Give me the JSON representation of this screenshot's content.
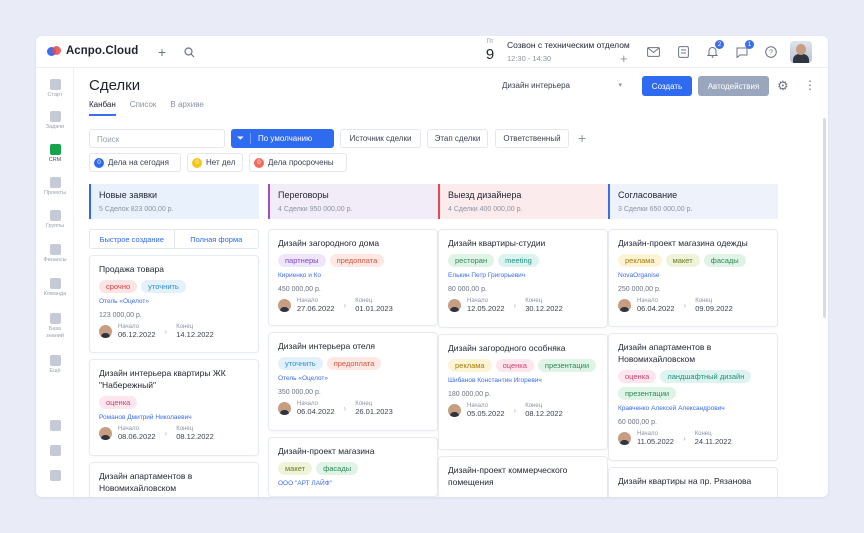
{
  "app": {
    "logo": "Аспро.Cloud"
  },
  "topbar": {
    "date_dow": "Пт",
    "date_num": "9",
    "event_title": "Созвон с техническим отделом",
    "event_time": "12:30 - 14:30",
    "tasks_badge": "2",
    "chat_badge": "1"
  },
  "sidebar": {
    "items": [
      {
        "label": "Старт"
      },
      {
        "label": "Задачи"
      },
      {
        "label": "CRM"
      },
      {
        "label": "Проекты"
      },
      {
        "label": "Группы"
      },
      {
        "label": "Финансы"
      },
      {
        "label": "Команда"
      },
      {
        "label": "База знаний"
      },
      {
        "label": "Ещё"
      }
    ]
  },
  "page": {
    "title": "Сделки",
    "tabs": [
      "Канбан",
      "Список",
      "В архиве"
    ],
    "funnel": "Дизайн интерьера",
    "create_label": "Создать",
    "auto_label": "Автодействия"
  },
  "filters": {
    "search_placeholder": "Поиск",
    "default_label": "По умолчанию",
    "chips": [
      "Источник сделки",
      "Этап сделки",
      "Ответственный"
    ],
    "quick": [
      {
        "count": "0",
        "label": "Дела на сегодня",
        "color": "#2f6bf0"
      },
      {
        "count": "0",
        "label": "Нет дел",
        "color": "#f5c518"
      },
      {
        "count": "0",
        "label": "Дела просрочены",
        "color": "#ef6c5a"
      }
    ]
  },
  "quick_create": {
    "fast": "Быстрое создание",
    "full": "Полная форма"
  },
  "columns": [
    {
      "title": "Новые заявки",
      "sub": "5 Сделок   823 000,00 р.",
      "accent": "#2f6bf0",
      "bg": "#e9f1fc",
      "cards": [
        {
          "title": "Продажа товара",
          "tags": [
            [
              "срочно",
              "red"
            ],
            [
              "уточнить",
              "blue"
            ]
          ],
          "org": "Отель «Оцелот»",
          "amount": "123 000,00 р.",
          "start": "06.12.2022",
          "end": "14.12.2022"
        },
        {
          "title": "Дизайн интерьера квартиры ЖК \"Набережный\"",
          "tags": [
            [
              "оценка",
              "pink"
            ]
          ],
          "org": "Романов Дмитрий Николаевич",
          "amount": "",
          "start": "08.06.2022",
          "end": "08.12.2022"
        },
        {
          "title": "Дизайн апартаментов в Новомихайловском",
          "tags": [],
          "org": "",
          "amount": "",
          "start": "",
          "end": ""
        }
      ]
    },
    {
      "title": "Переговоры",
      "sub": "4 Сделки   950 000,00 р.",
      "accent": "#9b4dca",
      "bg": "#f2ecf8",
      "cards": [
        {
          "title": "Дизайн загородного дома",
          "tags": [
            [
              "партнеры",
              "purple"
            ],
            [
              "предоплата",
              "salmon"
            ]
          ],
          "org": "Кириенко и Ко",
          "amount": "450 000,00 р.",
          "start": "27.06.2022",
          "end": "01.01.2023"
        },
        {
          "title": "Дизайн интерьера отеля",
          "tags": [
            [
              "уточнить",
              "blue"
            ],
            [
              "предоплата",
              "salmon"
            ]
          ],
          "org": "Отель «Оцелот»",
          "amount": "350 000,00 р.",
          "start": "06.04.2022",
          "end": "26.01.2023"
        },
        {
          "title": "Дизайн-проект магазина",
          "tags": [
            [
              "макет",
              "olive"
            ],
            [
              "фасады",
              "green"
            ]
          ],
          "org": "ООО \"АРТ ЛАЙФ\"",
          "amount": "",
          "start": "",
          "end": ""
        }
      ]
    },
    {
      "title": "Выезд дизайнера",
      "sub": "4 Сделки   400 000,00 р.",
      "accent": "#e5484d",
      "bg": "#fcebed",
      "cards": [
        {
          "title": "Дизайн квартиры-студии",
          "tags": [
            [
              "ресторан",
              "green"
            ],
            [
              "meeting",
              "teal"
            ]
          ],
          "org": "Елькин Петр Григорьевич",
          "amount": "80 000,00 р.",
          "start": "12.05.2022",
          "end": "30.12.2022"
        },
        {
          "title": "Дизайн загородного особняка",
          "tags": [
            [
              "реклама",
              "yellow"
            ],
            [
              "оценка",
              "pink"
            ],
            [
              "презентации",
              "green"
            ]
          ],
          "org": "Шибанов Константин Игоревич",
          "amount": "180 000,00 р.",
          "start": "05.05.2022",
          "end": "08.12.2022"
        },
        {
          "title": "Дизайн-проект коммерческого помещения",
          "tags": [],
          "org": "",
          "amount": "",
          "start": "",
          "end": ""
        }
      ]
    },
    {
      "title": "Согласование",
      "sub": "3 Сделки   650 000,00 р.",
      "accent": "#3a6df0",
      "bg": "#eef2fb",
      "cards": [
        {
          "title": "Дизайн-проект магазина одежды",
          "tags": [
            [
              "реклама",
              "yellow"
            ],
            [
              "макет",
              "olive"
            ],
            [
              "фасады",
              "green"
            ]
          ],
          "org": "NovaOrganise",
          "amount": "250 000,00 р.",
          "start": "06.04.2022",
          "end": "09.09.2022"
        },
        {
          "title": "Дизайн апартаментов в Новомихайловском",
          "tags": [
            [
              "оценка",
              "pink"
            ],
            [
              "ландшафтный дизайн",
              "teal"
            ],
            [
              "презентации",
              "green"
            ]
          ],
          "org": "Кравченко Алексей Александрович",
          "amount": "60 000,00 р.",
          "start": "11.05.2022",
          "end": "24.11.2022"
        },
        {
          "title": "Дизайн квартиры на пр. Рязанова",
          "tags": [],
          "org": "",
          "amount": "",
          "start": "",
          "end": ""
        }
      ]
    }
  ],
  "labels": {
    "start": "Начало",
    "end": "Конец"
  },
  "tag_colors": {
    "red": [
      "#fde4e4",
      "#d93b3b"
    ],
    "blue": [
      "#e2f1fb",
      "#2f8fcf"
    ],
    "pink": [
      "#fde6ee",
      "#cf3f73"
    ],
    "purple": [
      "#efe6fb",
      "#7b46c4"
    ],
    "salmon": [
      "#fde8e4",
      "#d9533b"
    ],
    "olive": [
      "#eef3d9",
      "#6c7a1e"
    ],
    "green": [
      "#dff4e7",
      "#2a8a52"
    ],
    "teal": [
      "#dcf3f0",
      "#1f8f80"
    ],
    "yellow": [
      "#fdf4d6",
      "#a77b06"
    ]
  }
}
